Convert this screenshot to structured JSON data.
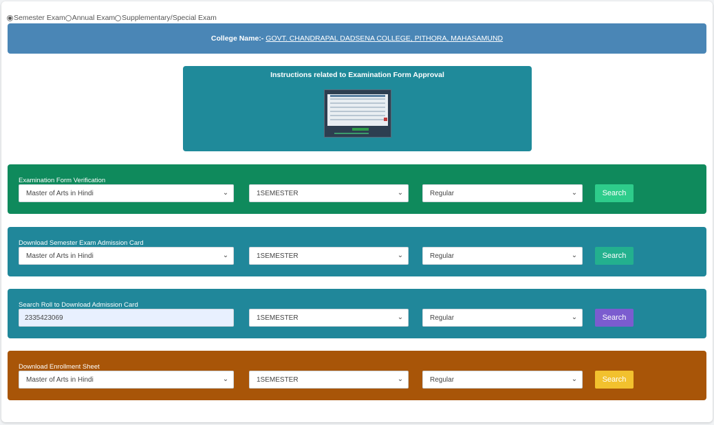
{
  "exam_types": [
    {
      "label": "Semester Exam",
      "checked": true
    },
    {
      "label": "Annual Exam",
      "checked": false
    },
    {
      "label": "Supplementary/Special Exam",
      "checked": false
    }
  ],
  "college": {
    "prefix": "College Name:-",
    "name": "GOVT. CHANDRAPAL DADSENA COLLEGE, PITHORA, MAHASAMUND"
  },
  "instructions": {
    "title": "Instructions related to Examination Form Approval"
  },
  "panels": [
    {
      "label": "Examination Form Verification",
      "course": "Master of Arts in Hindi",
      "semester": "1SEMESTER",
      "type": "Regular",
      "button": "Search",
      "color": "#0f8a5c",
      "button_color": "#2ecc8b"
    },
    {
      "label": "Download Semester Exam Admission Card",
      "course": "Master of Arts in Hindi",
      "semester": "1SEMESTER",
      "type": "Regular",
      "button": "Search",
      "color": "#20879a",
      "button_color": "#23b08e"
    },
    {
      "label": "Search Roll to Download Admission Card",
      "roll": "2335423069",
      "semester": "1SEMESTER",
      "type": "Regular",
      "button": "Search",
      "color": "#20879a",
      "button_color": "#7b5ccf"
    },
    {
      "label": "Download Enrollment Sheet",
      "course": "Master of Arts in Hindi",
      "semester": "1SEMESTER",
      "type": "Regular",
      "button": "Search",
      "color": "#a85508",
      "button_color": "#f2c12e"
    }
  ]
}
